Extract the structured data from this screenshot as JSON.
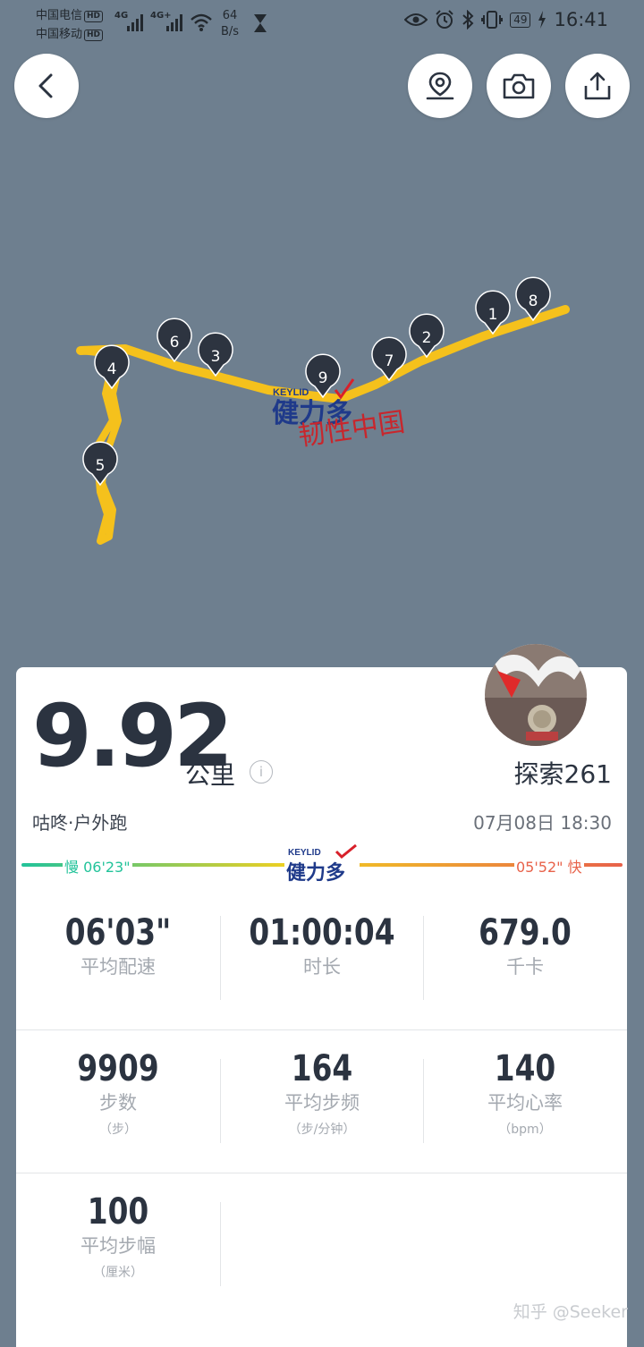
{
  "status_bar": {
    "carrier_1": "中国电信",
    "carrier_2": "中国移动",
    "hd_badge": "HD",
    "network_1": "4G",
    "network_2": "4G+",
    "net_speed_value": "64",
    "net_speed_unit": "B/s",
    "battery": "49",
    "time": "16:41"
  },
  "toolbar": {
    "back_icon": "chevron-left-icon",
    "location_icon": "map-pin-icon",
    "camera_icon": "camera-icon",
    "share_icon": "share-icon"
  },
  "map": {
    "markers": [
      "1",
      "2",
      "3",
      "4",
      "5",
      "6",
      "7",
      "8",
      "9"
    ],
    "route_color": "#f5c11c",
    "brand_en": "KEYLID",
    "brand_cn": "健力多",
    "calligraphy": "韧性中国"
  },
  "summary": {
    "distance": "9.92",
    "distance_unit": "公里",
    "info_icon": "i",
    "username": "探索261",
    "activity_type": "咕咚·户外跑",
    "datetime": "07月08日 18:30"
  },
  "pace_scale": {
    "slow_label": "慢 06'23\"",
    "fast_label": "05'52\" 快",
    "brand_en": "KEYLID",
    "brand_cn": "健力多",
    "slow_color": "#22c39a",
    "fast_color": "#e8624a"
  },
  "stats": [
    {
      "value": "06'03\"",
      "label": "平均配速",
      "sub": ""
    },
    {
      "value": "01:00:04",
      "label": "时长",
      "sub": ""
    },
    {
      "value": "679.0",
      "label": "千卡",
      "sub": ""
    },
    {
      "value": "9909",
      "label": "步数",
      "sub": "（步）"
    },
    {
      "value": "164",
      "label": "平均步频",
      "sub": "（步/分钟）"
    },
    {
      "value": "140",
      "label": "平均心率",
      "sub": "（bpm）"
    },
    {
      "value": "100",
      "label": "平均步幅",
      "sub": "（厘米）"
    }
  ],
  "watermark": "知乎 @Seeker"
}
